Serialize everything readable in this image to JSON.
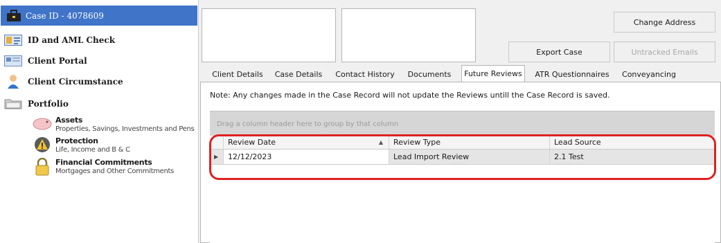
{
  "sidebar": {
    "case_title": "Case ID - 4078609",
    "items": [
      {
        "label": "ID and AML Check",
        "icon": "id-card-icon"
      },
      {
        "label": "Client Portal",
        "icon": "portal-icon"
      },
      {
        "label": "Client Circumstance",
        "icon": "person-icon"
      },
      {
        "label": "Portfolio",
        "icon": "folder-icon"
      }
    ],
    "portfolio": [
      {
        "title": "Assets",
        "desc": "Properties, Savings, Investments and Pens",
        "icon": "piggy-bank-icon"
      },
      {
        "title": "Protection",
        "desc": "Life, Income and B & C",
        "icon": "warning-shield-icon"
      },
      {
        "title": "Financial Commitments",
        "desc": "Mortgages and Other Commitments",
        "icon": "padlock-icon"
      }
    ]
  },
  "toolbar": {
    "change_address": "Change Address",
    "export_case": "Export Case",
    "untracked_emails": "Untracked Emails"
  },
  "tabs": [
    "Client Details",
    "Case Details",
    "Contact History",
    "Documents",
    "Future Reviews",
    "ATR Questionnaires",
    "Conveyancing"
  ],
  "active_tab": "Future Reviews",
  "note": "Note: Any changes made in the Case Record will not update the Reviews untill the Case Record is saved.",
  "grid": {
    "group_hint": "Drag a column header here to group by that column",
    "columns": [
      "Review Date",
      "Review Type",
      "Lead Source"
    ],
    "sort_indicator": "▲",
    "rows": [
      {
        "review_date": "12/12/2023",
        "review_type": "Lead Import Review",
        "lead_source": "2.1 Test"
      }
    ]
  },
  "colors": {
    "accent": "#3f74c8",
    "highlight": "#e02020"
  }
}
